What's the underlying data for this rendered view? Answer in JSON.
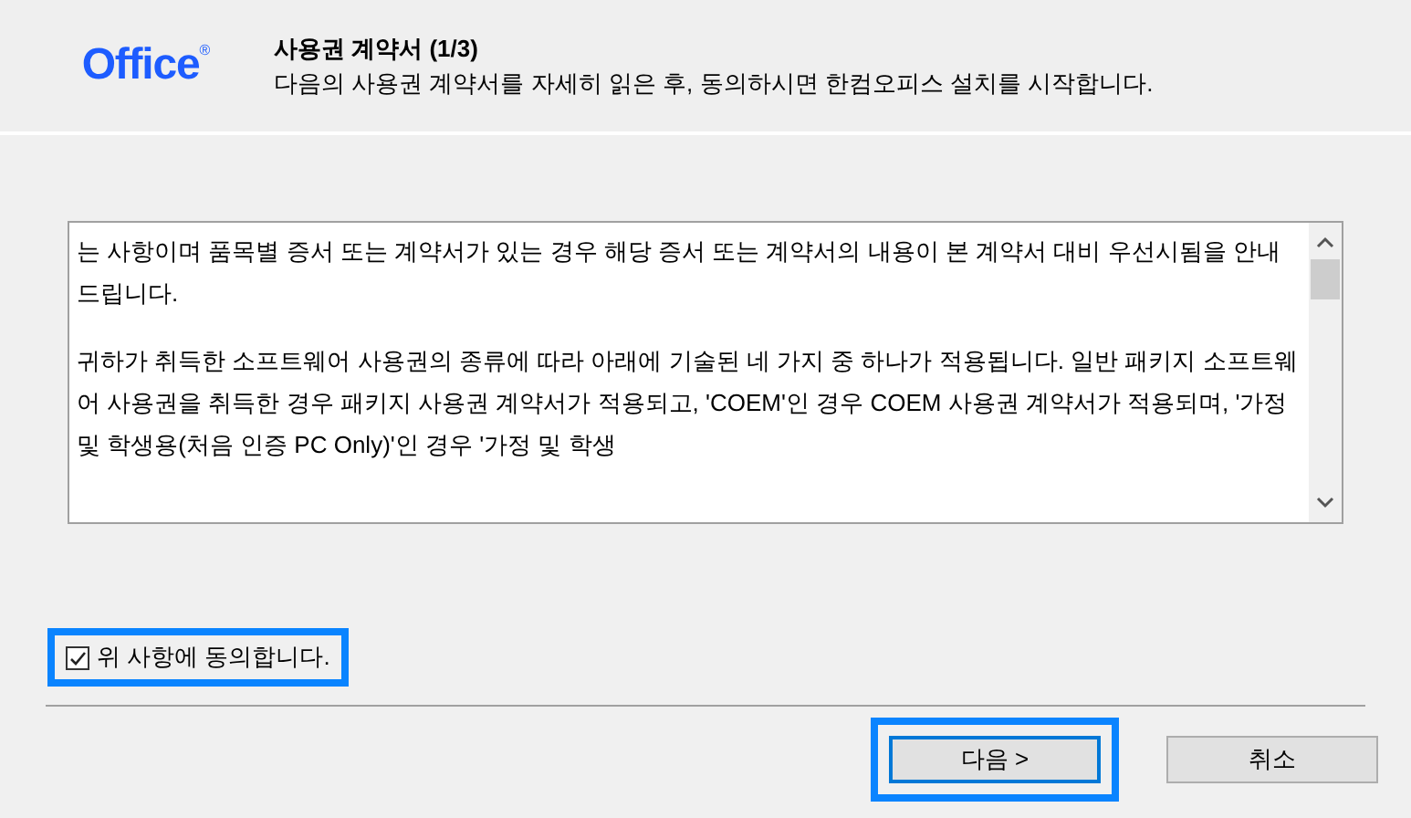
{
  "header": {
    "logo": "Office",
    "logo_mark": "®",
    "title": "사용권 계약서 (1/3)",
    "subtitle": "다음의 사용권 계약서를 자세히 읽은 후, 동의하시면 한컴오피스 설치를 시작합니다."
  },
  "license_text": {
    "paragraphs": [
      "는 사항이며 품목별 증서 또는 계약서가 있는 경우 해당 증서 또는 계약서의 내용이 본 계약서 대비 우선시됨을 안내드립니다.",
      "귀하가 취득한 소프트웨어 사용권의 종류에 따라 아래에 기술된 네 가지 중 하나가 적용됩니다. 일반 패키지 소프트웨어 사용권을 취득한 경우 패키지 사용권 계약서가 적용되고, 'COEM'인 경우 COEM 사용권 계약서가 적용되며, '가정 및 학생용(처음 인증 PC Only)'인 경우 '가정 및 학생"
    ]
  },
  "agree": {
    "label": "위 사항에 동의합니다.",
    "checked": true,
    "highlighted": true
  },
  "buttons": [
    {
      "label": "다음 >",
      "kind": "primary",
      "highlighted": true
    },
    {
      "label": "취소",
      "kind": "normal",
      "highlighted": false
    }
  ]
}
